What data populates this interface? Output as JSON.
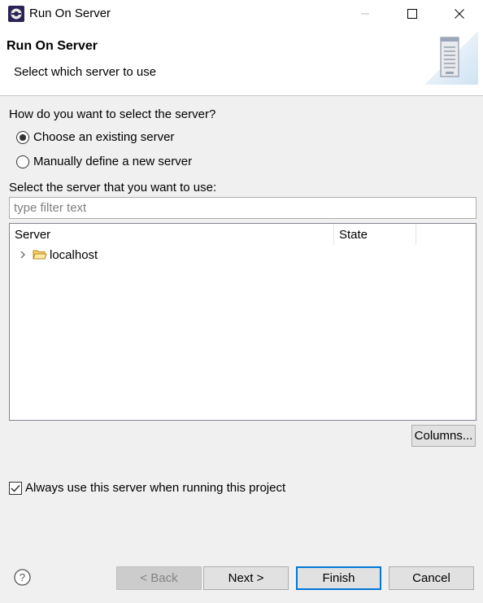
{
  "window": {
    "title": "Run On Server"
  },
  "header": {
    "title": "Run On Server",
    "subtitle": "Select which server to use"
  },
  "selection": {
    "question": "How do you want to select the server?",
    "existing_label": "Choose an existing server",
    "existing_selected": true,
    "manual_label": "Manually define a new server",
    "manual_selected": false
  },
  "server_list": {
    "label": "Select the server that you want to use:",
    "filter_placeholder": "type filter text",
    "filter_value": "",
    "columns": [
      "Server",
      "State"
    ],
    "rows": [
      {
        "name": "localhost",
        "state": ""
      }
    ],
    "columns_button": "Columns..."
  },
  "always_use": {
    "label": "Always use this server when running this project",
    "checked": true
  },
  "buttons": {
    "back": "< Back",
    "next": "Next >",
    "finish": "Finish",
    "cancel": "Cancel"
  },
  "colors": {
    "accent": "#0078d7",
    "panel": "#f0f0f0",
    "button": "#e1e1e1"
  }
}
